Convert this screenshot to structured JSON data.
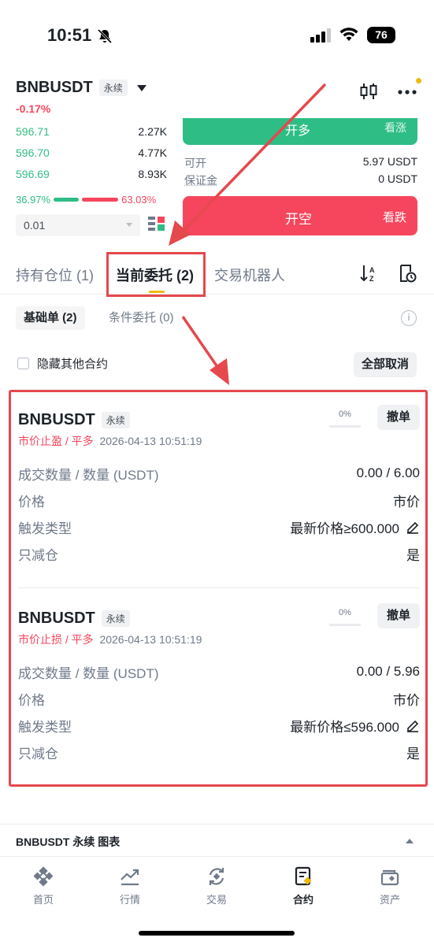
{
  "status_bar": {
    "time": "10:51",
    "battery": "76"
  },
  "header": {
    "symbol": "BNBUSDT",
    "contract_tag": "永续",
    "change": "-0.17%"
  },
  "order_book": {
    "bids": [
      {
        "price": "596.71",
        "qty": "2.27K",
        "depth": 0.35
      },
      {
        "price": "596.70",
        "qty": "4.77K",
        "depth": 0.62
      },
      {
        "price": "596.69",
        "qty": "8.93K",
        "depth": 1.0
      }
    ],
    "buy_ratio": "36.97%",
    "sell_ratio": "63.03%",
    "depth_value": "0.01"
  },
  "trade_panel": {
    "long_label": "开多",
    "long_sub": "看涨",
    "available_label": "可开",
    "available_value": "5.97 USDT",
    "margin_label": "保证金",
    "margin_value": "0 USDT",
    "short_label": "开空",
    "short_sub": "看跌"
  },
  "tabs": {
    "positions": "持有仓位 (1)",
    "open_orders": "当前委托 (2)",
    "bots": "交易机器人"
  },
  "subtabs": {
    "basic": "基础单 (2)",
    "conditional": "条件委托 (0)"
  },
  "filter": {
    "hide_other": "隐藏其他合约",
    "cancel_all": "全部取消"
  },
  "orders": [
    {
      "symbol": "BNBUSDT",
      "tag": "永续",
      "type": "市价止盈 / 平多",
      "time": "2026-04-13 10:51:19",
      "progress": "0%",
      "cancel": "撤单",
      "rows": [
        {
          "k": "成交数量 / 数量 (USDT)",
          "v": "0.00 / 6.00"
        },
        {
          "k": "价格",
          "v": "市价"
        },
        {
          "k": "触发类型",
          "v": "最新价格≥600.000"
        },
        {
          "k": "只减仓",
          "v": "是"
        }
      ]
    },
    {
      "symbol": "BNBUSDT",
      "tag": "永续",
      "type": "市价止损 / 平多",
      "time": "2026-04-13 10:51:19",
      "progress": "0%",
      "cancel": "撤单",
      "rows": [
        {
          "k": "成交数量 / 数量 (USDT)",
          "v": "0.00 / 5.96"
        },
        {
          "k": "价格",
          "v": "市价"
        },
        {
          "k": "触发类型",
          "v": "最新价格≤596.000"
        },
        {
          "k": "只减仓",
          "v": "是"
        }
      ]
    }
  ],
  "chart_bar": {
    "title": "BNBUSDT 永续 图表"
  },
  "bottom_nav": {
    "home": "首页",
    "markets": "行情",
    "trade": "交易",
    "futures": "合约",
    "assets": "资产"
  },
  "colors": {
    "green": "#2ebd85",
    "red": "#f6465d",
    "accent": "#f0b90b",
    "annotation": "#e5484d"
  }
}
